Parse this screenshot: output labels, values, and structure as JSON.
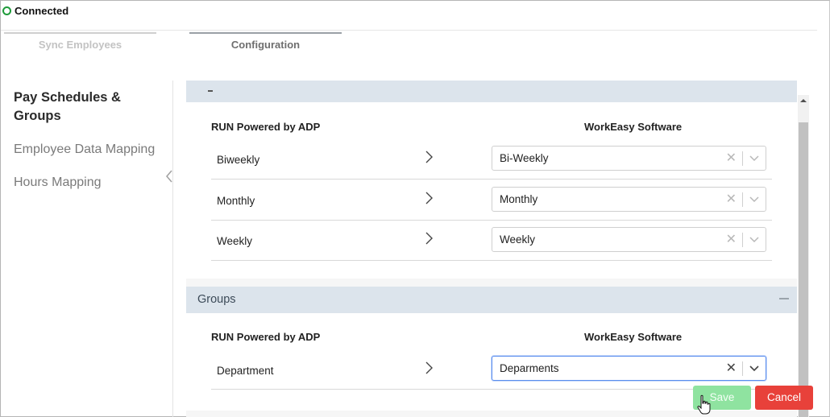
{
  "status": {
    "text": "Connected",
    "color": "#1e9b3a"
  },
  "tabs": [
    {
      "label": "Sync Employees",
      "active": false
    },
    {
      "label": "Configuration",
      "active": true
    }
  ],
  "sidebar": {
    "items": [
      {
        "label": "Pay Schedules & Groups",
        "active": true
      },
      {
        "label": "Employee Data Mapping",
        "active": false
      },
      {
        "label": "Hours Mapping",
        "active": false
      }
    ]
  },
  "pay_schedules": {
    "left_header": "RUN Powered by ADP",
    "right_header": "WorkEasy Software",
    "rows": [
      {
        "label": "Biweekly",
        "value": "Bi-Weekly"
      },
      {
        "label": "Monthly",
        "value": "Monthly"
      },
      {
        "label": "Weekly",
        "value": "Weekly"
      }
    ]
  },
  "groups": {
    "title": "Groups",
    "left_header": "RUN Powered by ADP",
    "right_header": "WorkEasy Software",
    "rows": [
      {
        "label": "Department",
        "value": "Deparments"
      }
    ]
  },
  "footer": {
    "save_label": "Save",
    "cancel_label": "Cancel"
  },
  "colors": {
    "section_header_bg": "#dce4ec",
    "save_bg": "#8fe3a0",
    "cancel_bg": "#e8413a",
    "focus_border": "#5a8dee"
  },
  "icons": {
    "clear": "close-icon",
    "dropdown": "chevron-down-icon",
    "row_arrow": "chevron-right-icon",
    "collapse": "minus-icon"
  }
}
